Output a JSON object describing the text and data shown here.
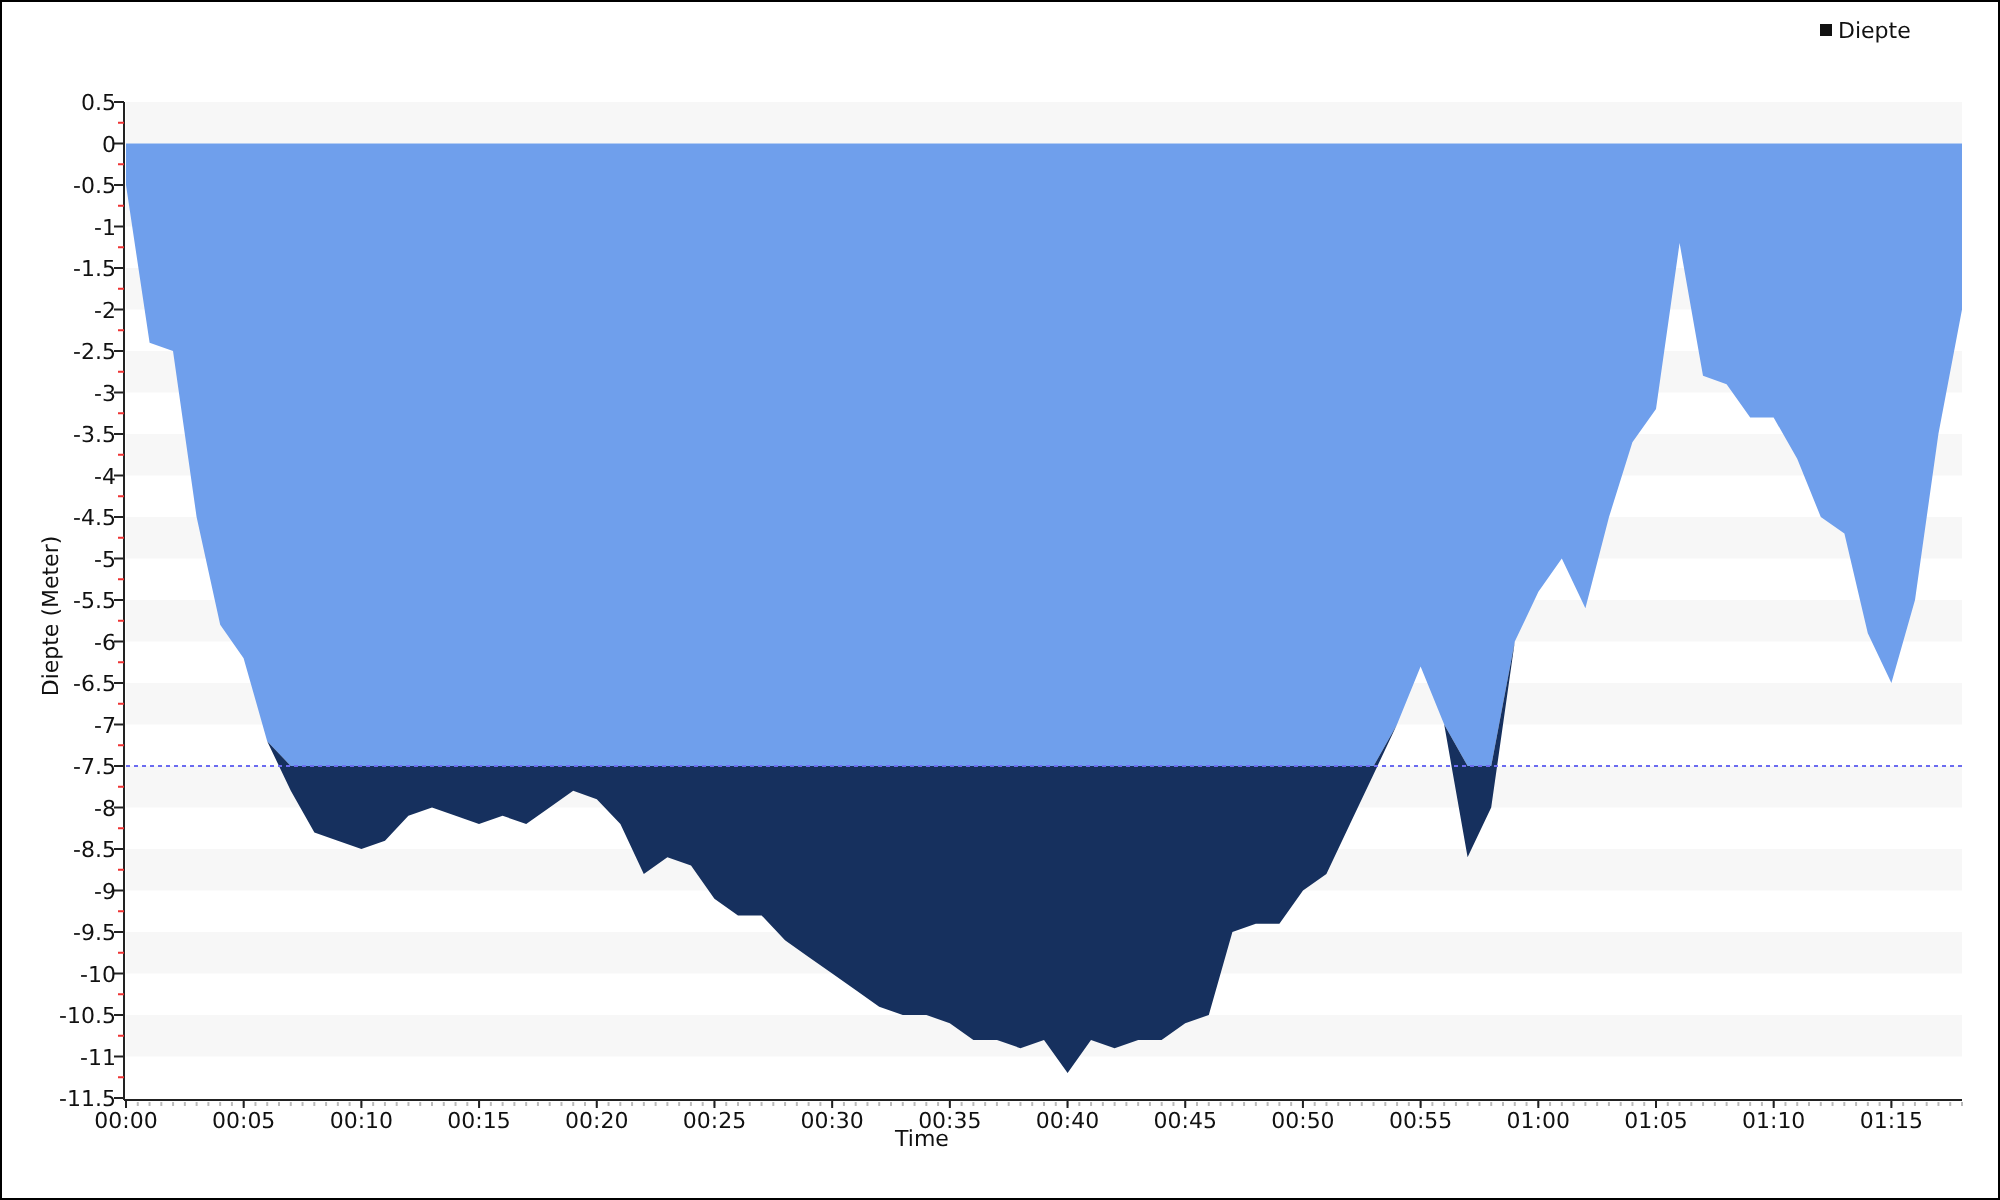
{
  "chart_data": {
    "type": "area",
    "xlabel": "Time",
    "ylabel": "Diepte (Meter)",
    "stacked": true,
    "x": [
      0,
      1,
      2,
      3,
      4,
      5,
      6,
      7,
      8,
      9,
      10,
      11,
      12,
      13,
      14,
      15,
      16,
      17,
      18,
      19,
      20,
      21,
      22,
      23,
      24,
      25,
      26,
      27,
      28,
      29,
      30,
      31,
      32,
      33,
      34,
      35,
      36,
      37,
      38,
      39,
      40,
      41,
      42,
      43,
      44,
      45,
      46,
      47,
      48,
      49,
      50,
      51,
      52,
      53,
      54,
      55,
      56,
      57,
      58,
      59,
      60,
      61,
      62,
      63,
      64,
      65,
      66,
      67,
      68,
      69,
      70,
      71,
      72,
      73,
      74,
      75,
      76,
      77,
      78
    ],
    "series": [
      {
        "name": "Diepte",
        "color": "#6f9fec",
        "values": [
          -0.5,
          -2.4,
          -2.5,
          -4.5,
          -5.8,
          -6.2,
          -7.2,
          -7.5,
          -7.5,
          -7.5,
          -7.5,
          -7.5,
          -7.5,
          -7.5,
          -7.5,
          -7.5,
          -7.5,
          -7.5,
          -7.5,
          -7.5,
          -7.5,
          -7.5,
          -7.5,
          -7.5,
          -7.5,
          -7.5,
          -7.5,
          -7.5,
          -7.5,
          -7.5,
          -7.5,
          -7.5,
          -7.5,
          -7.5,
          -7.5,
          -7.5,
          -7.5,
          -7.5,
          -7.5,
          -7.5,
          -7.5,
          -7.5,
          -7.5,
          -7.5,
          -7.5,
          -7.5,
          -7.5,
          -7.5,
          -7.5,
          -7.5,
          -7.5,
          -7.5,
          -7.5,
          -7.5,
          -7.0,
          -6.3,
          -7.0,
          -7.5,
          -7.5,
          -6.0,
          -5.4,
          -5.0,
          -5.6,
          -4.5,
          -3.6,
          -3.2,
          -1.2,
          -2.8,
          -2.9,
          -3.3,
          -3.3,
          -3.8,
          -4.5,
          -4.7,
          -5.9,
          -6.5,
          -5.5,
          -3.5,
          -2.0
        ]
      },
      {
        "color": "#16305e",
        "values": [
          0,
          0,
          0,
          0,
          0,
          0,
          0,
          -0.3,
          -0.8,
          -0.9,
          -1.0,
          -0.9,
          -0.6,
          -0.5,
          -0.6,
          -0.7,
          -0.6,
          -0.7,
          -0.5,
          -0.3,
          -0.4,
          -0.7,
          -1.3,
          -1.1,
          -1.2,
          -1.6,
          -1.8,
          -1.8,
          -2.1,
          -2.3,
          -2.5,
          -2.7,
          -2.9,
          -3.0,
          -3.0,
          -3.1,
          -3.3,
          -3.3,
          -3.4,
          -3.3,
          -3.7,
          -3.3,
          -3.4,
          -3.3,
          -3.3,
          -3.1,
          -3.0,
          -2.0,
          -1.9,
          -1.9,
          -1.5,
          -1.3,
          -0.7,
          -0.1,
          0,
          0,
          0,
          -1.1,
          -0.5,
          0,
          0,
          0,
          0,
          0,
          0,
          0,
          0,
          0,
          0,
          0,
          0,
          0,
          0,
          0,
          0,
          0,
          0,
          0,
          0
        ]
      }
    ],
    "xlim": [
      0,
      78
    ],
    "ylim": [
      -11.5,
      0.5
    ],
    "xticks": [
      {
        "value": 0,
        "label": "00:00"
      },
      {
        "value": 5,
        "label": "00:05"
      },
      {
        "value": 10,
        "label": "00:10"
      },
      {
        "value": 15,
        "label": "00:15"
      },
      {
        "value": 20,
        "label": "00:20"
      },
      {
        "value": 25,
        "label": "00:25"
      },
      {
        "value": 30,
        "label": "00:30"
      },
      {
        "value": 35,
        "label": "00:35"
      },
      {
        "value": 40,
        "label": "00:40"
      },
      {
        "value": 45,
        "label": "00:45"
      },
      {
        "value": 50,
        "label": "00:50"
      },
      {
        "value": 55,
        "label": "00:55"
      },
      {
        "value": 60,
        "label": "01:00"
      },
      {
        "value": 65,
        "label": "01:05"
      },
      {
        "value": 70,
        "label": "01:10"
      },
      {
        "value": 75,
        "label": "01:15"
      }
    ],
    "yticks": [
      0.5,
      0,
      -0.5,
      -1,
      -1.5,
      -2,
      -2.5,
      -3,
      -3.5,
      -4,
      -4.5,
      -5,
      -5.5,
      -6,
      -6.5,
      -7,
      -7.5,
      -8,
      -8.5,
      -9,
      -9.5,
      -10,
      -10.5,
      -11,
      -11.5
    ],
    "ref_lines": [
      {
        "axis": "y",
        "value": -7.5,
        "color": "#6b6bf0"
      }
    ]
  }
}
